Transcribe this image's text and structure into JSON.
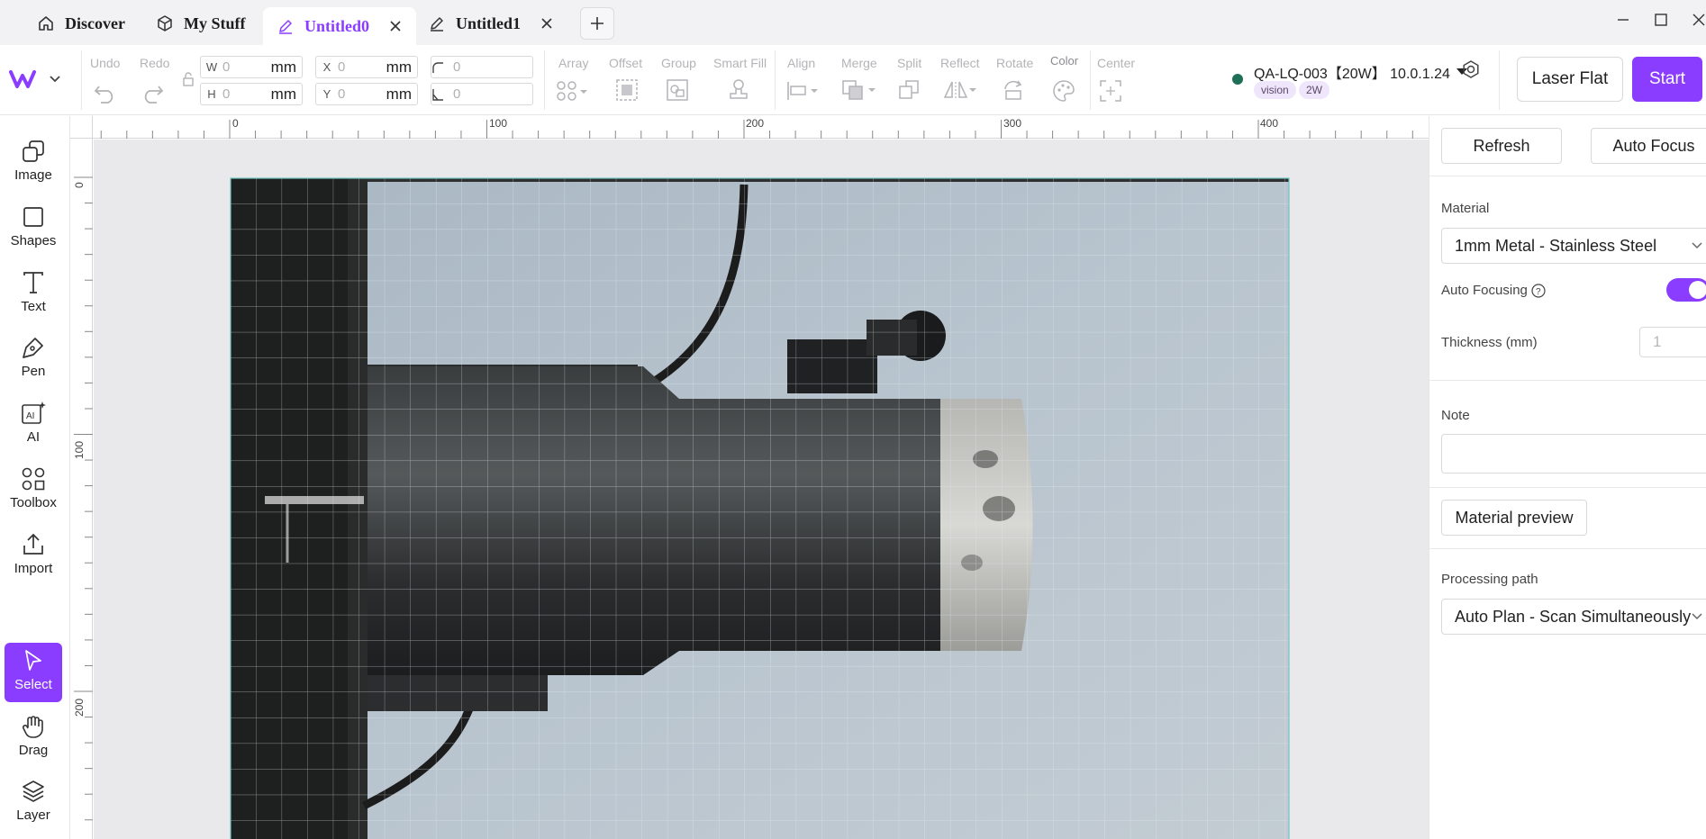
{
  "tabs": [
    {
      "label": "Discover",
      "icon": "home-icon"
    },
    {
      "label": "My Stuff",
      "icon": "box-icon"
    },
    {
      "label": "Untitled0",
      "icon": "pencil-icon",
      "active": true
    },
    {
      "label": "Untitled1",
      "icon": "pencil-icon"
    }
  ],
  "toolbar": {
    "undo": "Undo",
    "redo": "Redo",
    "width_prefix": "W",
    "width_value": "0",
    "width_unit": "mm",
    "height_prefix": "H",
    "height_value": "0",
    "height_unit": "mm",
    "x_prefix": "X",
    "x_value": "0",
    "x_unit": "mm",
    "y_prefix": "Y",
    "y_value": "0",
    "y_unit": "mm",
    "corner_radius_value": "0",
    "skew_value": "0",
    "array": "Array",
    "offset": "Offset",
    "group": "Group",
    "smart_fill": "Smart Fill",
    "align": "Align",
    "merge": "Merge",
    "split": "Split",
    "reflect": "Reflect",
    "rotate": "Rotate",
    "color": "Color",
    "center": "Center"
  },
  "device": {
    "name": "QA-LQ-003【20W】 10.0.1.24",
    "status_color": "#1f6f58",
    "badges": [
      "vision",
      "2W"
    ]
  },
  "actions": {
    "laser_flat": "Laser Flat",
    "start": "Start"
  },
  "left_tools": [
    {
      "label": "Image"
    },
    {
      "label": "Shapes"
    },
    {
      "label": "Text"
    },
    {
      "label": "Pen"
    },
    {
      "label": "AI"
    },
    {
      "label": "Toolbox"
    },
    {
      "label": "Import"
    },
    {
      "label": "Select",
      "active": true
    },
    {
      "label": "Drag"
    },
    {
      "label": "Layer"
    }
  ],
  "ruler": {
    "h_labels": [
      "0",
      "100",
      "200",
      "300",
      "400"
    ],
    "v_labels": [
      "0",
      "100",
      "200"
    ]
  },
  "panel": {
    "refresh": "Refresh",
    "auto_focus": "Auto Focus",
    "material_label": "Material",
    "material_value": "1mm Metal - Stainless Steel",
    "auto_focusing_label": "Auto Focusing",
    "auto_focusing_on": true,
    "thickness_label": "Thickness (mm)",
    "thickness_value": "1",
    "note_label": "Note",
    "note_value": "",
    "material_preview": "Material preview",
    "processing_path_label": "Processing path",
    "processing_path_value": "Auto Plan - Scan Simultaneously"
  },
  "colors": {
    "accent": "#8b3dff",
    "canvas_bg": "#e9e9eb"
  }
}
